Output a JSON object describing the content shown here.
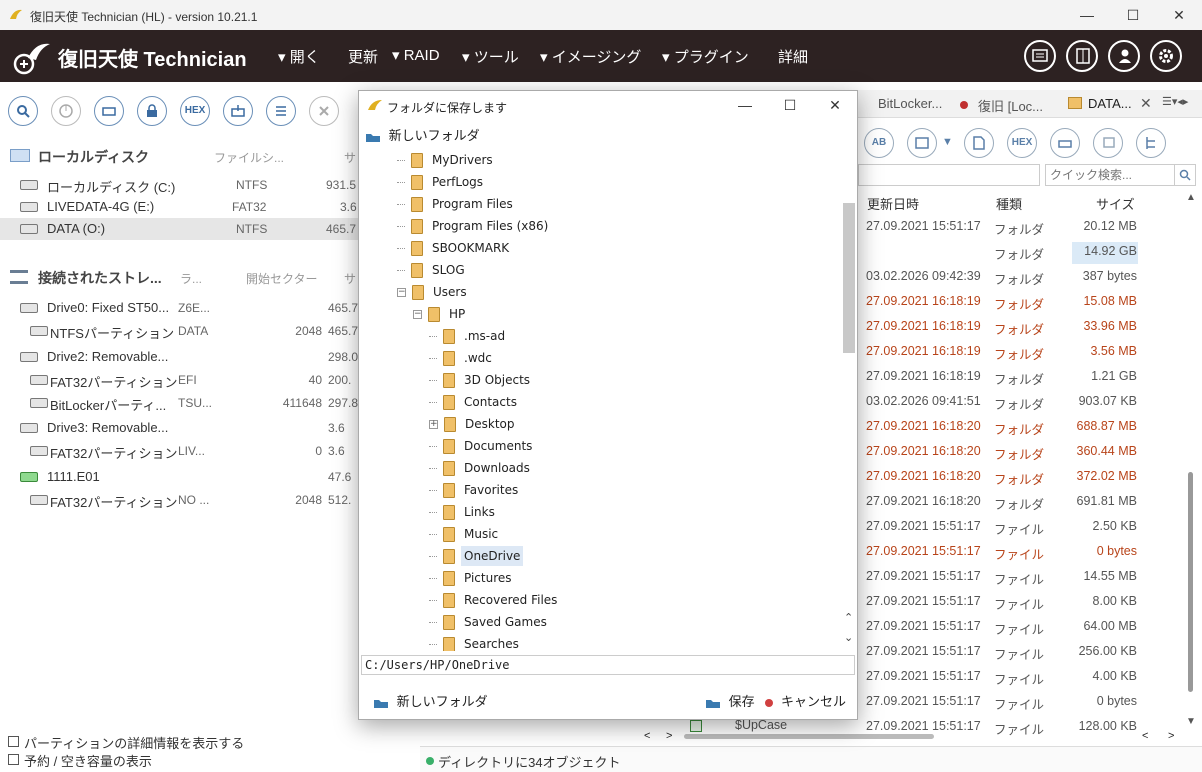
{
  "window": {
    "title": "復旧天使 Technician (HL) - version 10.21.1",
    "minimize": "—",
    "maximize": "☐",
    "close": "✕"
  },
  "header": {
    "app_name": "復旧天使 Technician",
    "menu": [
      "開く",
      "更新",
      "RAID",
      "ツール",
      "イメージング",
      "プラグイン",
      "詳細"
    ]
  },
  "left_toolbar": {
    "hex_label": "HEX"
  },
  "local": {
    "heading": "ローカルディスク",
    "col_fs": "ファイルシ...",
    "col_size": "サ",
    "rows": [
      {
        "name": "ローカルディスク (C:)",
        "fs": "NTFS",
        "size": "931.5"
      },
      {
        "name": "LIVEDATA-4G (E:)",
        "fs": "FAT32",
        "size": "3.6"
      },
      {
        "name": "DATA (O:)",
        "fs": "NTFS",
        "size": "465.7"
      }
    ]
  },
  "storage": {
    "heading": "接続されたストレ...",
    "col_label": "ラ...",
    "col_start": "開始セクター",
    "col_size": "サ",
    "rows": [
      {
        "name": "Drive0: Fixed ST50...",
        "label": "Z6E...",
        "start": "",
        "size": "465.7"
      },
      {
        "name": "NTFSパーティション",
        "label": "DATA",
        "start": "2048",
        "size": "465.7"
      },
      {
        "name": "Drive2: Removable...",
        "label": "",
        "start": "",
        "size": "298.0"
      },
      {
        "name": "FAT32パーティション",
        "label": "EFI",
        "start": "40",
        "size": "200."
      },
      {
        "name": "BitLockerパーティ...",
        "label": "TSU...",
        "start": "411648",
        "size": "297.8"
      },
      {
        "name": "Drive3: Removable...",
        "label": "",
        "start": "",
        "size": "3.6"
      },
      {
        "name": "FAT32パーティション",
        "label": "LIV...",
        "start": "0",
        "size": "3.6"
      },
      {
        "name": "1111.E01",
        "label": "",
        "start": "",
        "size": "47.6"
      },
      {
        "name": "FAT32パーティション",
        "label": "NO ...",
        "start": "2048",
        "size": "512."
      }
    ]
  },
  "options": {
    "show_partition_details": "パーティションの詳細情報を表示する",
    "show_reserved": "予約 / 空き容量の表示"
  },
  "tabs": [
    "BitLocker...",
    "復旧 [Loc...",
    "DATA..."
  ],
  "right_toolbar": {
    "hex_label": "HEX"
  },
  "search": {
    "placeholder": "クイック検索..."
  },
  "file_table": {
    "headers": [
      "更新日時",
      "種類",
      "サイズ"
    ],
    "rows": [
      {
        "date": "27.09.2021 15:51:17",
        "type": "フォルダ",
        "size": "20.12 MB",
        "red": false
      },
      {
        "date": "",
        "type": "フォルダ",
        "size": "14.92 GB",
        "red": false
      },
      {
        "date": "03.02.2026 09:42:39",
        "type": "フォルダ",
        "size": "387 bytes",
        "red": false
      },
      {
        "date": "27.09.2021 16:18:19",
        "type": "フォルダ",
        "size": "15.08 MB",
        "red": true
      },
      {
        "date": "27.09.2021 16:18:19",
        "type": "フォルダ",
        "size": "33.96 MB",
        "red": true
      },
      {
        "date": "27.09.2021 16:18:19",
        "type": "フォルダ",
        "size": "3.56 MB",
        "red": true
      },
      {
        "date": "27.09.2021 16:18:19",
        "type": "フォルダ",
        "size": "1.21 GB",
        "red": false
      },
      {
        "date": "03.02.2026 09:41:51",
        "type": "フォルダ",
        "size": "903.07 KB",
        "red": false
      },
      {
        "date": "27.09.2021 16:18:20",
        "type": "フォルダ",
        "size": "688.87 MB",
        "red": true
      },
      {
        "date": "27.09.2021 16:18:20",
        "type": "フォルダ",
        "size": "360.44 MB",
        "red": true
      },
      {
        "date": "27.09.2021 16:18:20",
        "type": "フォルダ",
        "size": "372.02 MB",
        "red": true
      },
      {
        "date": "27.09.2021 16:18:20",
        "type": "フォルダ",
        "size": "691.81 MB",
        "red": false
      },
      {
        "date": "27.09.2021 15:51:17",
        "type": "ファイル",
        "size": "2.50 KB",
        "red": false
      },
      {
        "date": "27.09.2021 15:51:17",
        "type": "ファイル",
        "size": "0 bytes",
        "red": true
      },
      {
        "date": "27.09.2021 15:51:17",
        "type": "ファイル",
        "size": "14.55 MB",
        "red": false
      },
      {
        "date": "27.09.2021 15:51:17",
        "type": "ファイル",
        "size": "8.00 KB",
        "red": false
      },
      {
        "date": "27.09.2021 15:51:17",
        "type": "ファイル",
        "size": "64.00 MB",
        "red": false
      },
      {
        "date": "27.09.2021 15:51:17",
        "type": "ファイル",
        "size": "256.00 KB",
        "red": false
      },
      {
        "date": "27.09.2021 15:51:17",
        "type": "ファイル",
        "size": "4.00 KB",
        "red": false
      },
      {
        "date": "27.09.2021 15:51:17",
        "type": "ファイル",
        "size": "0 bytes",
        "red": false
      },
      {
        "date": "27.09.2021 15:51:17",
        "type": "ファイル",
        "size": "128.00 KB",
        "red": false
      }
    ],
    "partial_name": "$UpCase"
  },
  "status": {
    "text": "ディレクトリに34オブジェクト"
  },
  "dialog": {
    "title": "フォルダに保存します",
    "new_folder_top": "新しいフォルダ",
    "tree": [
      {
        "name": "MyDrivers",
        "level": 0
      },
      {
        "name": "PerfLogs",
        "level": 0
      },
      {
        "name": "Program Files",
        "level": 0
      },
      {
        "name": "Program Files (x86)",
        "level": 0
      },
      {
        "name": "SBOOKMARK",
        "level": 0
      },
      {
        "name": "SLOG",
        "level": 0
      },
      {
        "name": "Users",
        "level": 0
      },
      {
        "name": "HP",
        "level": 1
      },
      {
        "name": ".ms-ad",
        "level": 2
      },
      {
        "name": ".wdc",
        "level": 2
      },
      {
        "name": "3D Objects",
        "level": 2
      },
      {
        "name": "Contacts",
        "level": 2
      },
      {
        "name": "Desktop",
        "level": 2
      },
      {
        "name": "Documents",
        "level": 2
      },
      {
        "name": "Downloads",
        "level": 2
      },
      {
        "name": "Favorites",
        "level": 2
      },
      {
        "name": "Links",
        "level": 2
      },
      {
        "name": "Music",
        "level": 2
      },
      {
        "name": "OneDrive",
        "level": 2
      },
      {
        "name": "Pictures",
        "level": 2
      },
      {
        "name": "Recovered Files",
        "level": 2
      },
      {
        "name": "Saved Games",
        "level": 2
      },
      {
        "name": "Searches",
        "level": 2
      }
    ],
    "selected": "OneDrive",
    "path": "C:/Users/HP/OneDrive",
    "new_folder_bottom": "新しいフォルダ",
    "save": "保存",
    "cancel": "キャンセル"
  }
}
